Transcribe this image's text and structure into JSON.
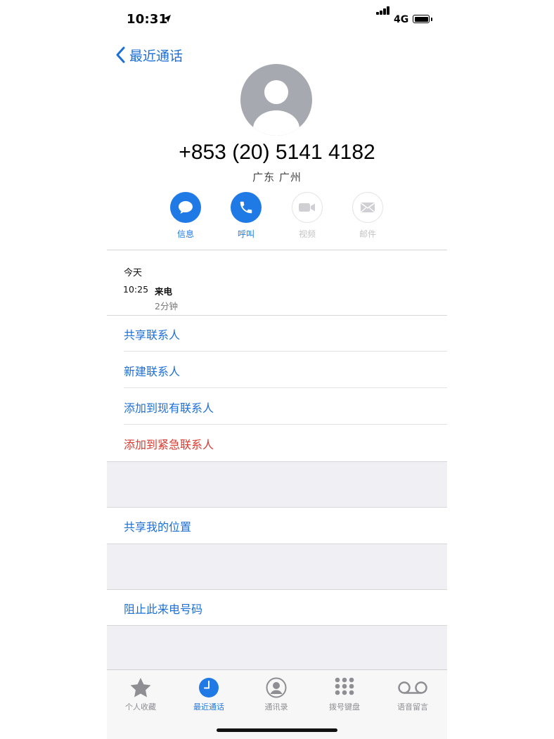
{
  "status": {
    "time": "10:31",
    "network": "4G"
  },
  "nav": {
    "back_label": "最近通话"
  },
  "contact": {
    "number": "+853 (20) 5141 4182",
    "location": "广东 广州"
  },
  "actions": [
    {
      "label": "信息",
      "icon": "message-icon",
      "enabled": true
    },
    {
      "label": "呼叫",
      "icon": "phone-icon",
      "enabled": true
    },
    {
      "label": "视频",
      "icon": "video-icon",
      "enabled": false
    },
    {
      "label": "邮件",
      "icon": "mail-icon",
      "enabled": false
    }
  ],
  "history": {
    "day": "今天",
    "time": "10:25",
    "type": "来电",
    "duration": "2分钟"
  },
  "options": {
    "share_contact": "共享联系人",
    "new_contact": "新建联系人",
    "add_existing": "添加到现有联系人",
    "add_emergency": "添加到紧急联系人",
    "share_location": "共享我的位置",
    "block_caller": "阻止此来电号码"
  },
  "tabs": [
    {
      "label": "个人收藏",
      "icon": "star-icon",
      "selected": false
    },
    {
      "label": "最近通话",
      "icon": "clock-icon",
      "selected": true
    },
    {
      "label": "通讯录",
      "icon": "contacts-icon",
      "selected": false
    },
    {
      "label": "拨号键盘",
      "icon": "keypad-icon",
      "selected": false
    },
    {
      "label": "语音留言",
      "icon": "voicemail-icon",
      "selected": false
    }
  ],
  "colors": {
    "accent": "#1f7ae6",
    "destructive": "#d93a2f",
    "group_background": "#efeff4"
  }
}
